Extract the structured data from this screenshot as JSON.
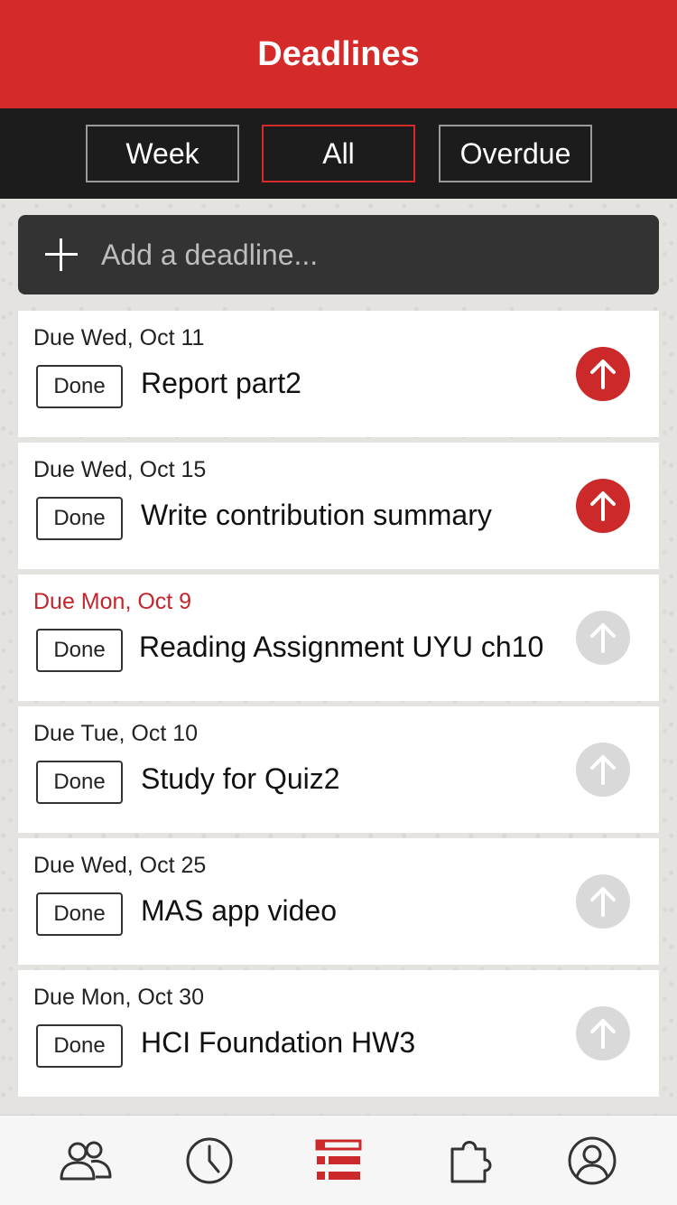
{
  "header": {
    "title": "Deadlines"
  },
  "filters": [
    {
      "label": "Week",
      "active": false
    },
    {
      "label": "All",
      "active": true
    },
    {
      "label": "Overdue",
      "active": false
    }
  ],
  "add_bar": {
    "placeholder": "Add a deadline...",
    "icon": "plus-icon"
  },
  "done_label": "Done",
  "tasks": [
    {
      "due": "Due Wed, Oct 11",
      "title": "Report part2",
      "overdue": false,
      "high_priority": true
    },
    {
      "due": "Due Wed, Oct 15",
      "title": "Write contribution summary",
      "overdue": false,
      "high_priority": true
    },
    {
      "due": "Due Mon, Oct 9",
      "title": "Reading Assignment UYU ch10",
      "overdue": true,
      "high_priority": false
    },
    {
      "due": "Due Tue, Oct 10",
      "title": "Study for Quiz2",
      "overdue": false,
      "high_priority": false
    },
    {
      "due": "Due Wed, Oct 25",
      "title": "MAS app video",
      "overdue": false,
      "high_priority": false
    },
    {
      "due": "Due Mon, Oct 30",
      "title": "HCI Foundation HW3",
      "overdue": false,
      "high_priority": false
    }
  ],
  "tabbar": [
    {
      "icon": "people-icon",
      "active": false
    },
    {
      "icon": "clock-icon",
      "active": false
    },
    {
      "icon": "list-icon",
      "active": true
    },
    {
      "icon": "puzzle-icon",
      "active": false
    },
    {
      "icon": "profile-icon",
      "active": false
    }
  ],
  "colors": {
    "accent": "#d52a2a",
    "priority_high": "#cc2a2a",
    "priority_normal": "#d9d9d9",
    "overdue_text": "#c0272d",
    "tab_icon": "#333333"
  }
}
